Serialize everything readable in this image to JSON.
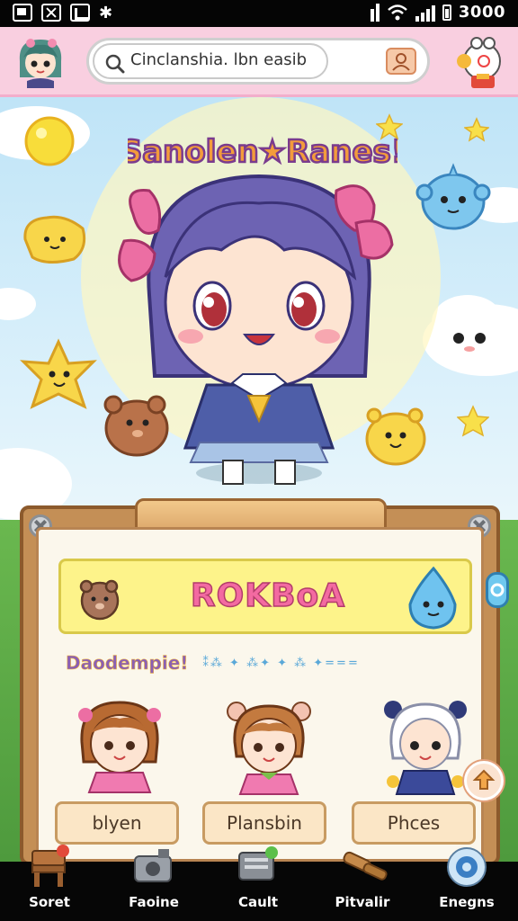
{
  "status_bar": {
    "time": "3000"
  },
  "header": {
    "search_placeholder": "Cinclanshia. lbn easib"
  },
  "hero": {
    "title": "Sanolen★Ranes!"
  },
  "panel": {
    "banner_title": "ROKBoA",
    "section_title": "Daodempie!",
    "section_deco": "⁑⁂ ✦ ⁂✦ ✦ ⁂ ✦===",
    "characters": [
      {
        "label": "blyen"
      },
      {
        "label": "Plansbin"
      },
      {
        "label": "Phces"
      }
    ]
  },
  "bottom_nav": [
    {
      "label": "Soret",
      "icon": "chair-icon"
    },
    {
      "label": "Faoine",
      "icon": "camera-icon"
    },
    {
      "label": "Cault",
      "icon": "cart-icon"
    },
    {
      "label": "Pitvalir",
      "icon": "hammer-icon"
    },
    {
      "label": "Enegns",
      "icon": "settings-icon"
    }
  ],
  "colors": {
    "header_bg": "#f9cfe0",
    "sky": "#bfe4f7",
    "panel_wood": "#c48f56",
    "banner_yellow": "#fdf38a",
    "title_pink": "#f36aa1"
  }
}
